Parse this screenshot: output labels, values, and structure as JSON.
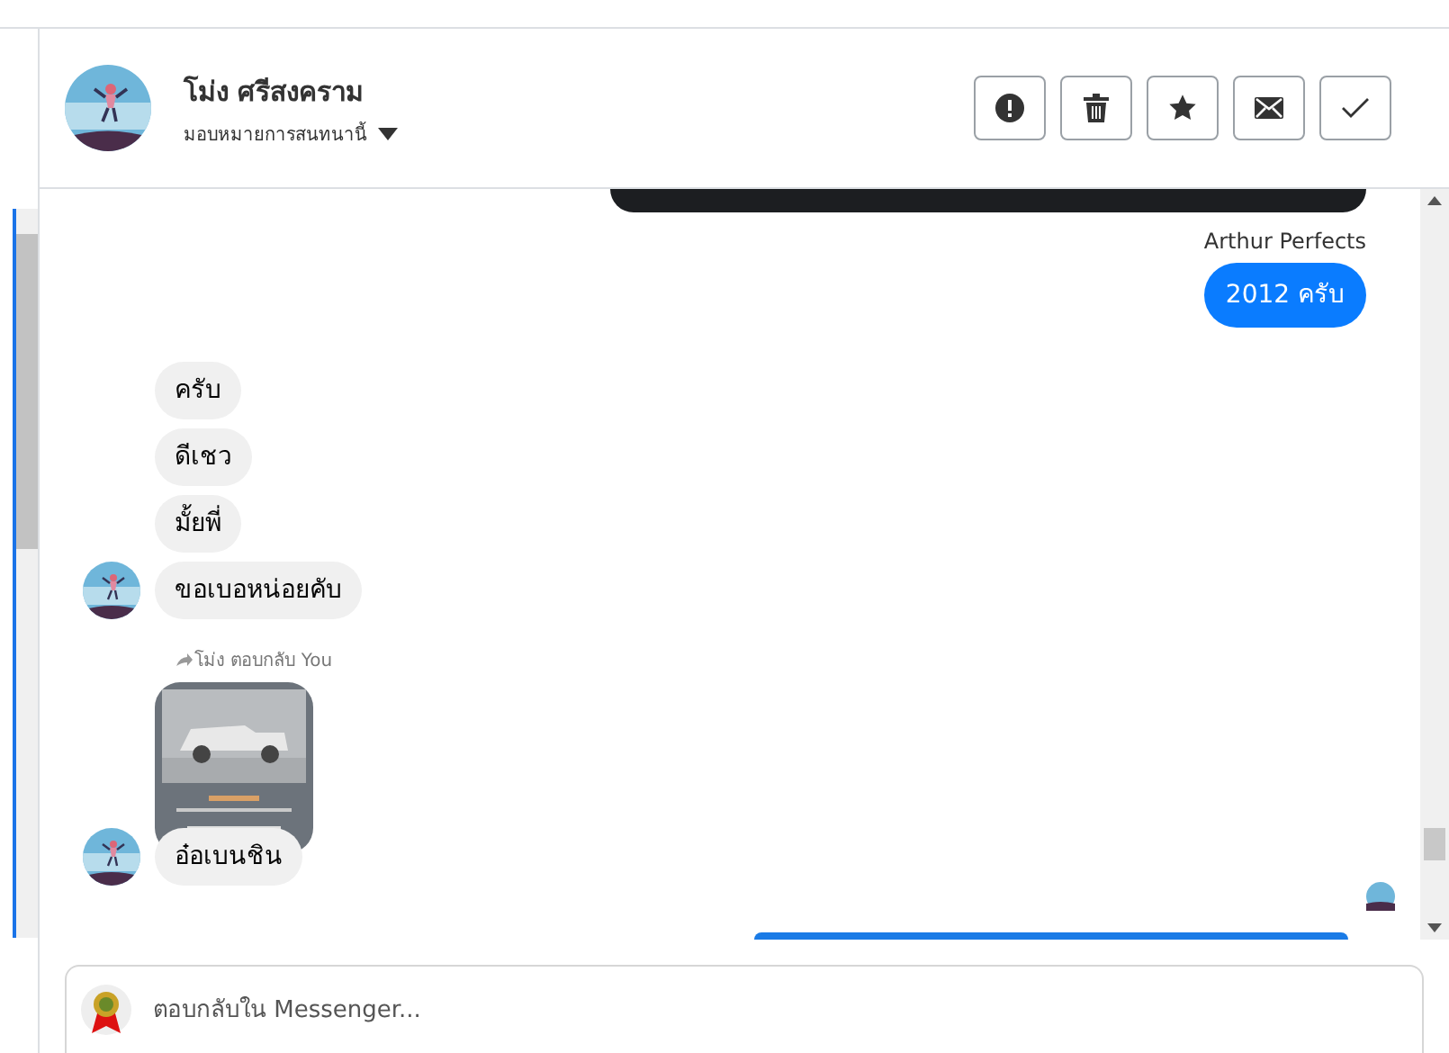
{
  "header": {
    "name": "โม่ง ศรีสงคราม",
    "assign": "มอบหมายการสนทนานี้"
  },
  "actions": [
    {
      "kind": "alert"
    },
    {
      "kind": "trash"
    },
    {
      "kind": "star"
    },
    {
      "kind": "mail"
    },
    {
      "kind": "check"
    }
  ],
  "messages": [
    {
      "kind": "dark-cut"
    },
    {
      "kind": "sender",
      "text": "Arthur Perfects"
    },
    {
      "kind": "sent",
      "text": "2012 ครับ"
    },
    {
      "kind": "received",
      "text": "ครับ",
      "avatar": false
    },
    {
      "kind": "received",
      "text": "ดีเชว",
      "avatar": false
    },
    {
      "kind": "received",
      "text": "มั้ยพี่",
      "avatar": false
    },
    {
      "kind": "received",
      "text": "ขอเบอหน่อยคับ",
      "avatar": true
    },
    {
      "kind": "reply-note",
      "text": "โม่ง ตอบกลับ You"
    },
    {
      "kind": "received-photo",
      "text": "อ๋อเบนชิน",
      "avatar": true
    },
    {
      "kind": "blue-cut"
    }
  ],
  "composer": {
    "placeholder": "ตอบกลับใน Messenger..."
  }
}
